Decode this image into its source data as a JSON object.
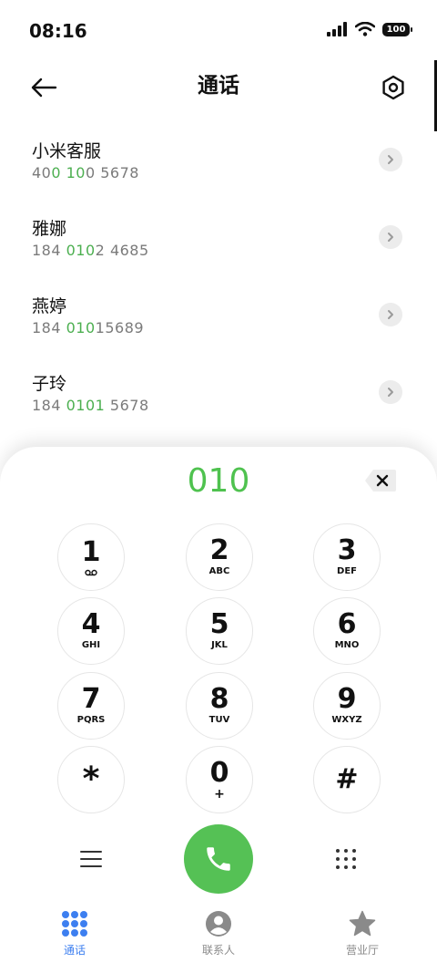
{
  "status_bar": {
    "time": "08:16",
    "battery": "100"
  },
  "header": {
    "title": "通话",
    "back_icon": "arrow-left-icon",
    "settings_icon": "hexagon-settings-icon"
  },
  "results": [
    {
      "name": "小米客服",
      "number_pre": "40",
      "number_match": "0 10",
      "number_post": "0 5678"
    },
    {
      "name": "雅娜",
      "number_pre": "184 ",
      "number_match": "010",
      "number_post": "2 4685"
    },
    {
      "name": "燕婷",
      "number_pre": "184 ",
      "number_match": "010",
      "number_post": "15689"
    },
    {
      "name": "子玲",
      "number_pre": "184 ",
      "number_match": "0101",
      "number_post": " 5678"
    }
  ],
  "dialer": {
    "input": "010",
    "keys": [
      {
        "digit": "1",
        "letters": ""
      },
      {
        "digit": "2",
        "letters": "ABC"
      },
      {
        "digit": "3",
        "letters": "DEF"
      },
      {
        "digit": "4",
        "letters": "GHI"
      },
      {
        "digit": "5",
        "letters": "JKL"
      },
      {
        "digit": "6",
        "letters": "MNO"
      },
      {
        "digit": "7",
        "letters": "PQRS"
      },
      {
        "digit": "8",
        "letters": "TUV"
      },
      {
        "digit": "9",
        "letters": "WXYZ"
      },
      {
        "digit": "*",
        "letters": ""
      },
      {
        "digit": "0",
        "letters": "+"
      },
      {
        "digit": "#",
        "letters": ""
      }
    ]
  },
  "tabs": [
    {
      "label": "通话",
      "icon": "dots-grid-icon",
      "active": true
    },
    {
      "label": "联系人",
      "icon": "person-icon",
      "active": false
    },
    {
      "label": "营业厅",
      "icon": "star-icon",
      "active": false
    }
  ],
  "colors": {
    "accent": "#4caf50",
    "call": "#55c155",
    "tab_active": "#3d7ff0",
    "tab_inactive": "#8a8a8a"
  }
}
